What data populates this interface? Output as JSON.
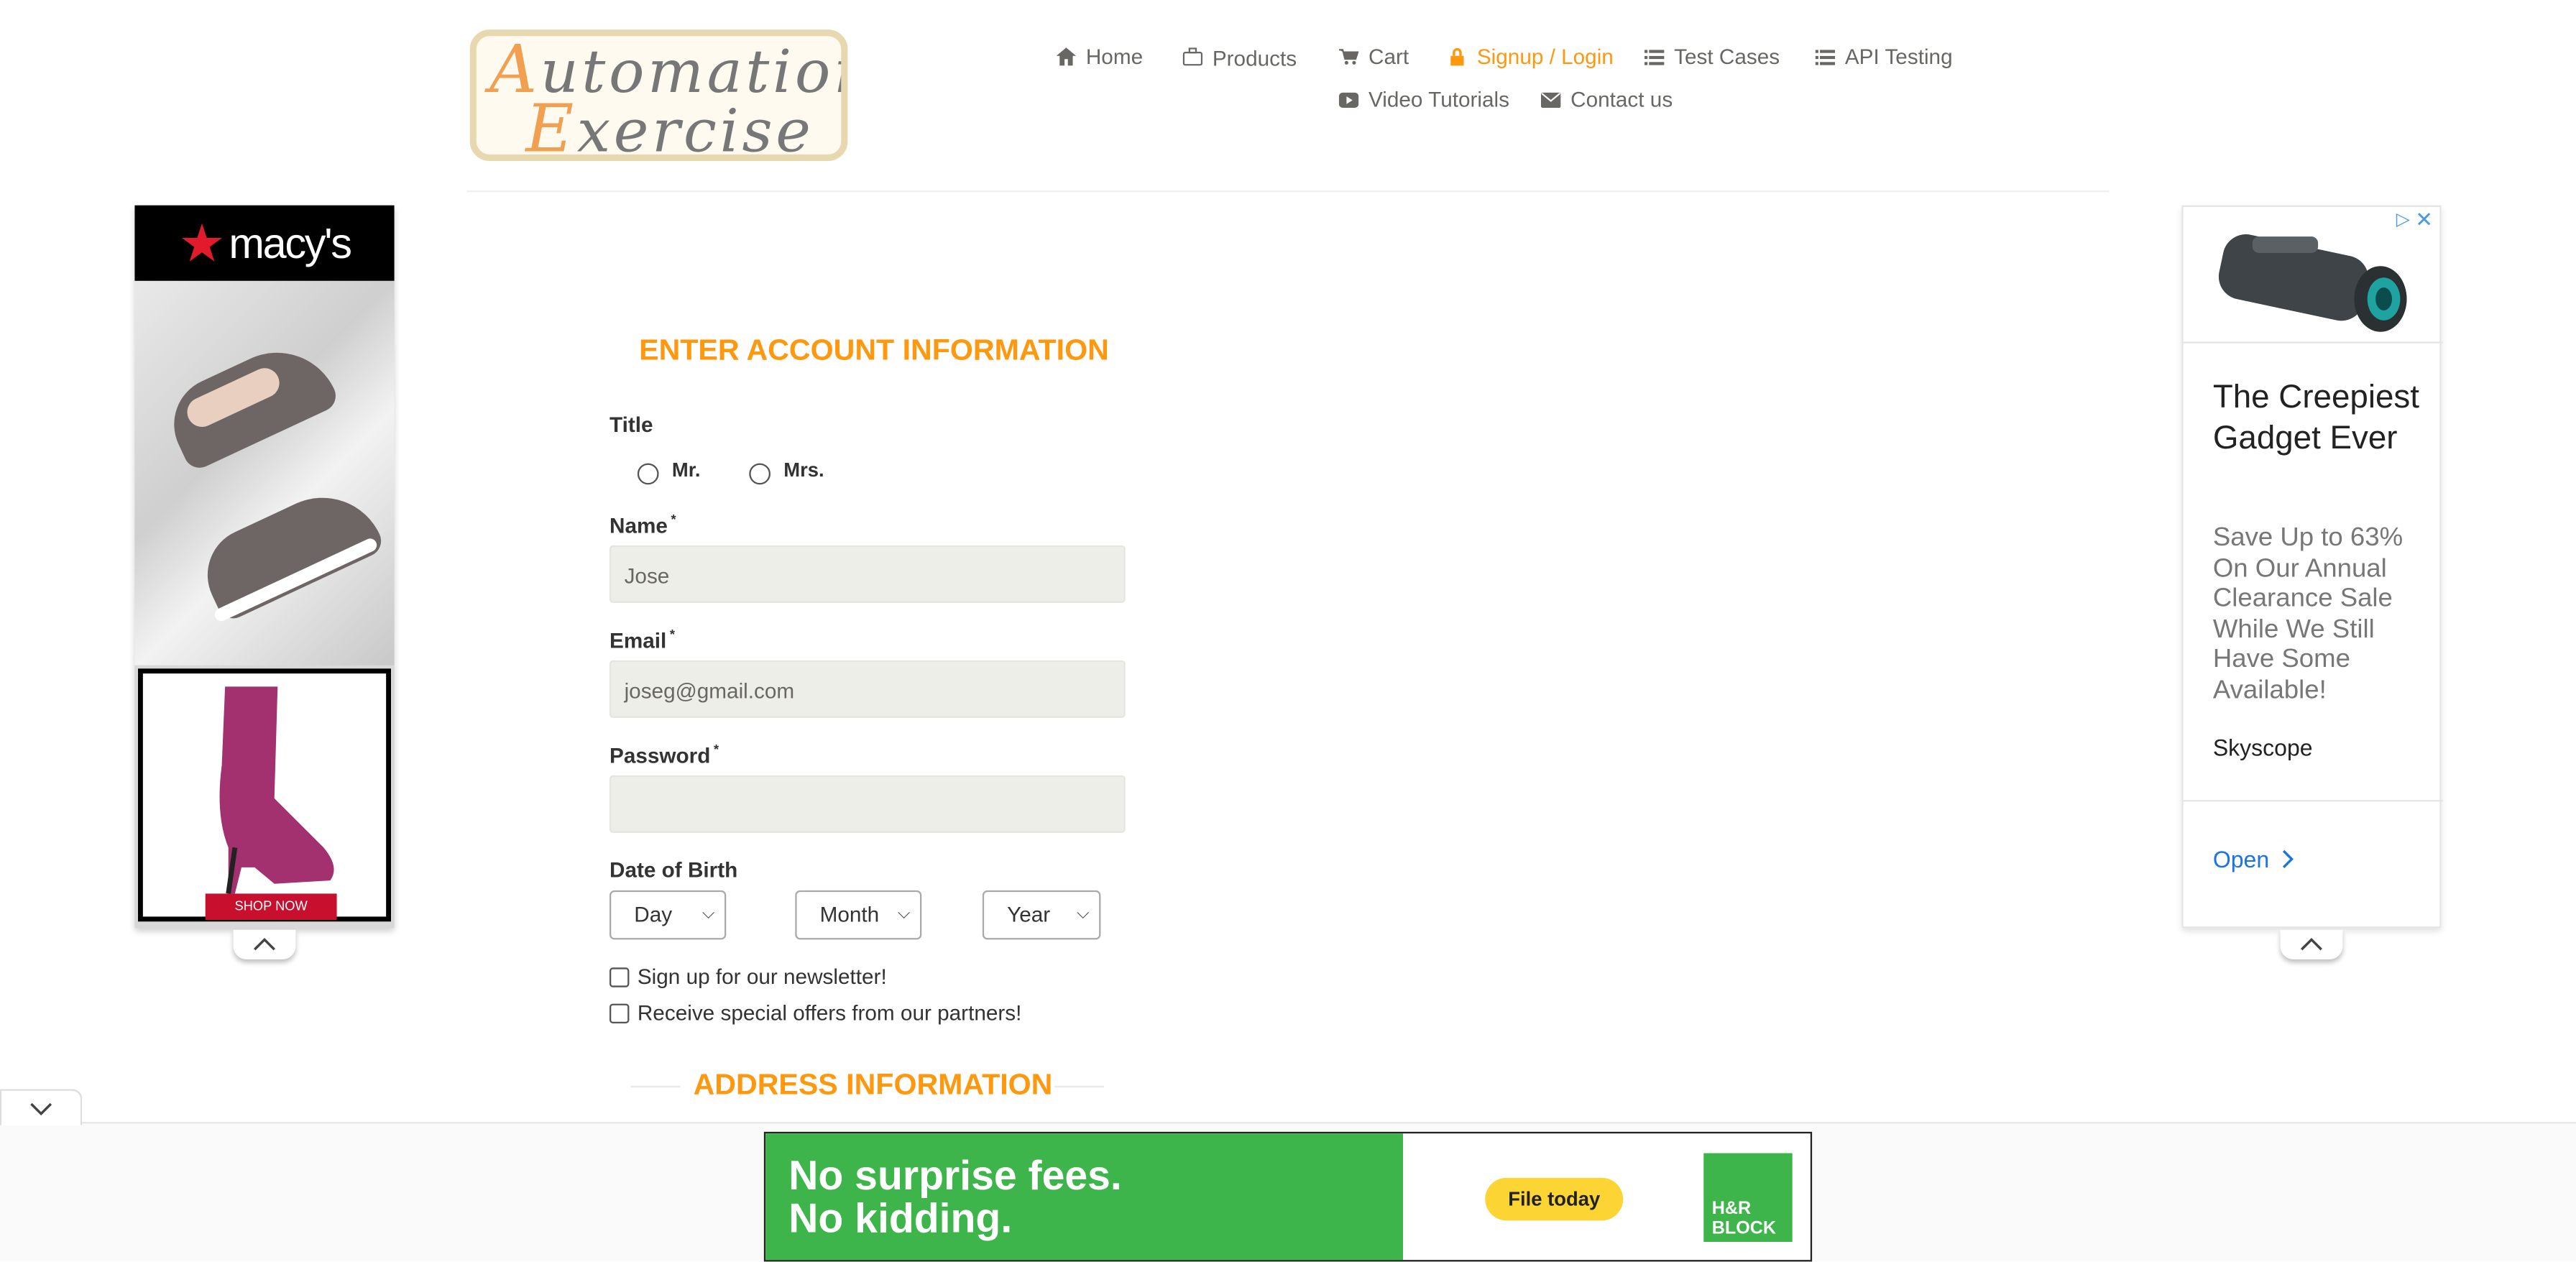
{
  "header": {
    "logo": {
      "line1_cap": "A",
      "line1_rest": "utomation",
      "line2_cap": "E",
      "line2_rest": "xercise"
    },
    "nav": [
      {
        "label": "Home",
        "icon": "home-icon"
      },
      {
        "label": "Products",
        "icon": "briefcase-icon"
      },
      {
        "label": "Cart",
        "icon": "cart-icon"
      },
      {
        "label": "Signup / Login",
        "icon": "lock-icon",
        "active": true
      },
      {
        "label": "Test Cases",
        "icon": "list-icon"
      },
      {
        "label": "API Testing",
        "icon": "list-icon"
      },
      {
        "label": "Video Tutorials",
        "icon": "youtube-icon"
      },
      {
        "label": "Contact us",
        "icon": "envelope-icon"
      }
    ]
  },
  "ad_left": {
    "brand": "macy's",
    "cta": "SHOP NOW"
  },
  "ad_right": {
    "title": "The Creepiest Gadget Ever",
    "description": "Save Up to 63% On Our Annual Clearance Sale While We Still Have Some Available!",
    "brand": "Skyscope",
    "open_label": "Open"
  },
  "form": {
    "heading": "ENTER ACCOUNT INFORMATION",
    "title_label": "Title",
    "title_options": [
      "Mr.",
      "Mrs."
    ],
    "name_label": "Name",
    "name_value": "Jose",
    "email_label": "Email",
    "email_value": "joseg@gmail.com",
    "password_label": "Password",
    "password_value": "",
    "required_mark": "*",
    "dob_label": "Date of Birth",
    "day_selected": "Day",
    "month_selected": "Month",
    "year_selected": "Year",
    "newsletter_label": "Sign up for our newsletter!",
    "offers_label": "Receive special offers from our partners!",
    "address_heading": "ADDRESS INFORMATION"
  },
  "banner": {
    "line1": "No surprise fees.",
    "line2": "No kidding.",
    "cta": "File today",
    "brand_line1": "H&R",
    "brand_line2": "BLOCK"
  },
  "colors": {
    "accent": "#fe980f",
    "input_bg": "#eeeee9",
    "banner_green": "#3db54a",
    "cta_yellow": "#fcd535"
  }
}
